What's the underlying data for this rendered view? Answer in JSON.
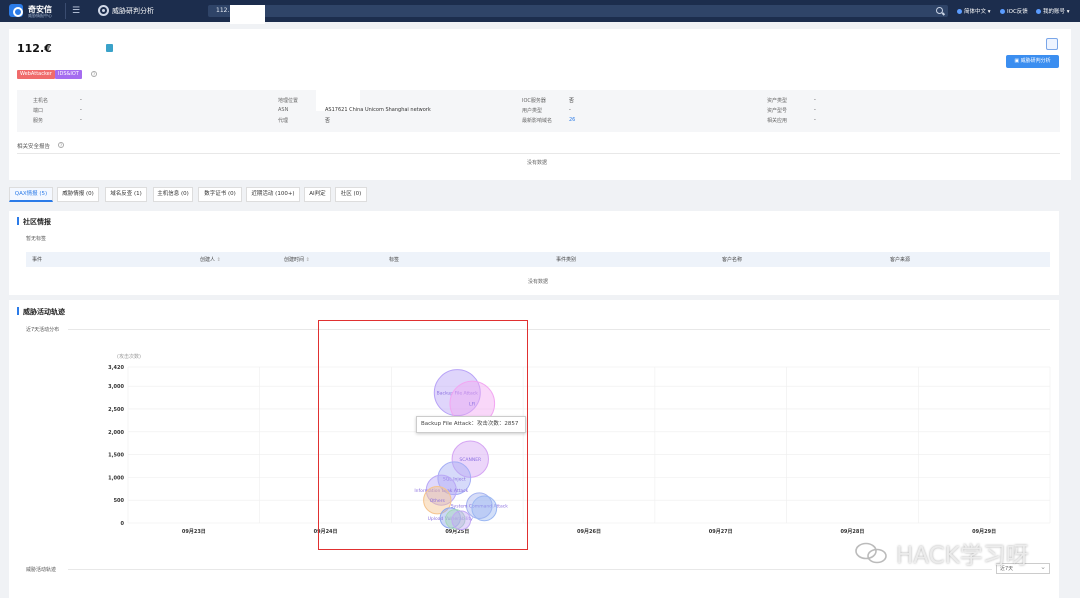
{
  "header": {
    "brand": "奇安信",
    "brand_sub": "威胁情报中心",
    "app_title": "威胁研判分析",
    "search_value": "112.",
    "lang": "简体中文",
    "ioc": "IOC反馈",
    "account": "我的账号"
  },
  "summary": {
    "ip": "112.€",
    "tags": [
      "WebAttacker",
      "IDS&IOT"
    ],
    "report_button": "威胁研判分析",
    "fields": {
      "host": {
        "label": "主机名",
        "value": "-"
      },
      "port": {
        "label": "端口",
        "value": "-"
      },
      "service": {
        "label": "服务",
        "value": "-"
      },
      "geo": {
        "label": "地理位置",
        "value": ""
      },
      "asn": {
        "label": "ASN",
        "value": "AS17621 China Unicom Shanghai network"
      },
      "proxy": {
        "label": "代理",
        "value": "否"
      },
      "ioc_server": {
        "label": "IOC服务器",
        "value": "否"
      },
      "user_type": {
        "label": "用户类型",
        "value": "-"
      },
      "domains": {
        "label": "最新影响域名",
        "value": "26"
      },
      "asset_type": {
        "label": "资产类型",
        "value": "-"
      },
      "asset_model": {
        "label": "资产型号",
        "value": "-"
      },
      "related_app": {
        "label": "相关应用",
        "value": "-"
      }
    },
    "security_report_title": "相关安全报告",
    "no_data": "没有数据"
  },
  "tabs": [
    "QAX情报 (5)",
    "威胁情报 (0)",
    "域名反查 (1)",
    "主机信息 (0)",
    "数字证书 (0)",
    "近期活动 (100+)",
    "AI判定",
    "社区 (0)"
  ],
  "community": {
    "title": "社区情报",
    "subtitle": "暂无标签",
    "columns": [
      "事件",
      "创建人",
      "创建时间",
      "标签",
      "事件类别",
      "客户名称",
      "客户来源"
    ],
    "no_data": "没有数据"
  },
  "activity": {
    "title": "威胁活动轨迹",
    "subtitle": "近7天活动分布",
    "footer_title": "威胁活动轨迹",
    "range_select": "近7天",
    "tooltip": "Backup File Attack：攻击次数：2857"
  },
  "chart_data": {
    "type": "scatter",
    "ylabel": "(攻击次数)",
    "ylim": [
      0,
      3420
    ],
    "yticks": [
      "3,420",
      "3,000",
      "2,500",
      "2,000",
      "1,500",
      "1,000",
      "500",
      "0"
    ],
    "xticks": [
      "09月23日",
      "09月24日",
      "09月25日",
      "09月26日",
      "09月27日",
      "09月28日",
      "09月29日"
    ],
    "points": [
      {
        "name": "Backup File Attack",
        "day": "09月25日",
        "value": 2857,
        "color": "#b7a2f7"
      },
      {
        "name": "LFI",
        "day": "09月25日",
        "value": 2620,
        "color": "#f2a7f2"
      },
      {
        "name": "SCANNER",
        "day": "09月25日",
        "value": 1400,
        "color": "#d5a5f3"
      },
      {
        "name": "SQL Inject",
        "day": "09月25日",
        "value": 980,
        "color": "#a5aef5"
      },
      {
        "name": "Information Leak Attack",
        "day": "09月25日",
        "value": 720,
        "color": "#b9a8f6"
      },
      {
        "name": "Others",
        "day": "09月25日",
        "value": 500,
        "color": "#f5c48e"
      },
      {
        "name": "System Command Attack",
        "day": "09月25日",
        "value": 380,
        "color": "#a6b4f0"
      },
      {
        "name": "Directory",
        "day": "09月25日",
        "value": 320,
        "color": "#9cb8f2"
      },
      {
        "name": "Upload Vulnerability",
        "day": "09月25日",
        "value": 110,
        "color": "#8ea7ee"
      },
      {
        "name": "Weak Password",
        "day": "09月25日",
        "value": 80,
        "color": "#a6d8b8"
      },
      {
        "name": "Scan Detect",
        "day": "09月25日",
        "value": 60,
        "color": "#c2a8f4"
      }
    ],
    "labels_shown": [
      "Backup File Attack",
      "LFI",
      "SCANNER",
      "SQL Inject",
      "Information Leak Attack",
      "Others",
      "System Command Attack",
      "Upload Vulnerability"
    ]
  },
  "watermark": "HACK学习呀"
}
